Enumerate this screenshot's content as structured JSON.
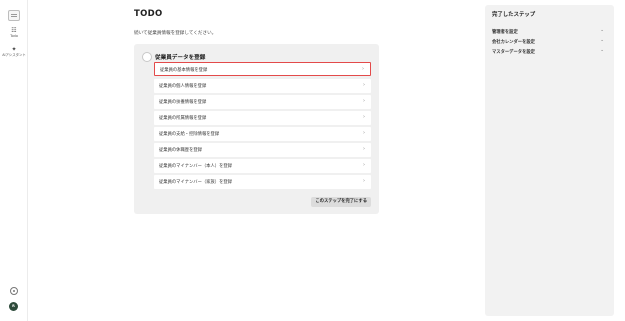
{
  "sidebar": {
    "items": [
      {
        "label": "Todo",
        "icon": "checklist-icon"
      },
      {
        "label": "AIアシスタント",
        "icon": "sparkle-icon"
      }
    ],
    "avatar": "R"
  },
  "main": {
    "title": "TODO",
    "subtitle": "続いて従業員情報を登録してください。",
    "step": {
      "title": "従業員データを登録",
      "items": [
        "従業員の基本情報を登録",
        "従業員の個人情報を登録",
        "従業員の扶養情報を登録",
        "従業員の所属情報を登録",
        "従業員の支給・控除情報を登録",
        "従業員の休職歴を登録",
        "従業員のマイナンバー（本人）を登録",
        "従業員のマイナンバー（家族）を登録"
      ],
      "active_index": 0,
      "complete_label": "このステップを完了にする"
    }
  },
  "completed": {
    "title": "完了したステップ",
    "items": [
      "管理者を設定",
      "会社カレンダーを設定",
      "マスターデータを設定"
    ]
  },
  "colors": {
    "highlight": "#e34a4a",
    "card_bg": "#f0f0f0",
    "panel_bg": "#f2f2f2"
  }
}
